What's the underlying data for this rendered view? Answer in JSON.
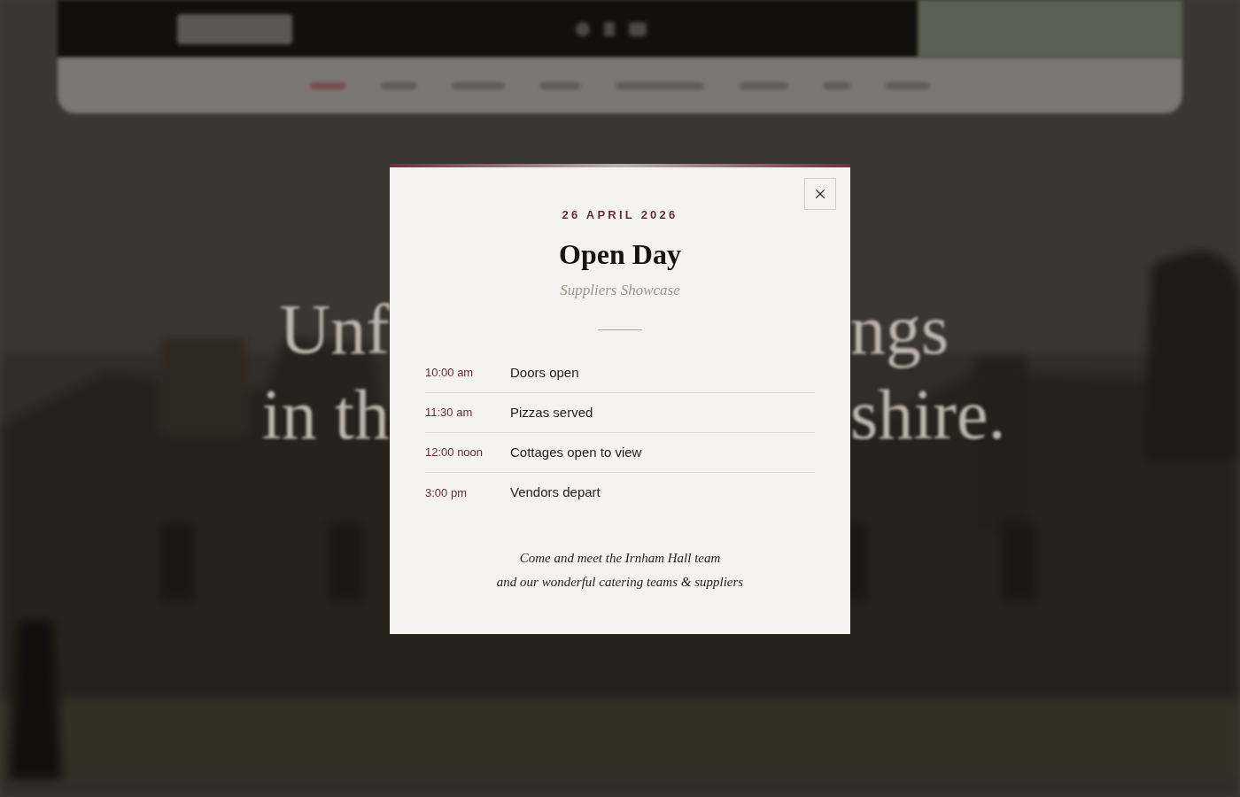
{
  "hero": {
    "lines": [
      {
        "left": "Unf",
        "right": "ngs"
      },
      {
        "left": "in th",
        "right": "shire."
      }
    ]
  },
  "modal": {
    "date": "26 APRIL 2026",
    "title": "Open Day",
    "subtitle": "Suppliers Showcase",
    "schedule": [
      {
        "time": "10:00 am",
        "event": "Doors open"
      },
      {
        "time": "11:30 am",
        "event": "Pizzas served"
      },
      {
        "time": "12:00 noon",
        "event": "Cottages open to view"
      },
      {
        "time": "3:00 pm",
        "event": "Vendors depart"
      }
    ],
    "note": [
      "Come and meet the Irnham Hall team",
      "and our wonderful catering teams & suppliers"
    ]
  }
}
